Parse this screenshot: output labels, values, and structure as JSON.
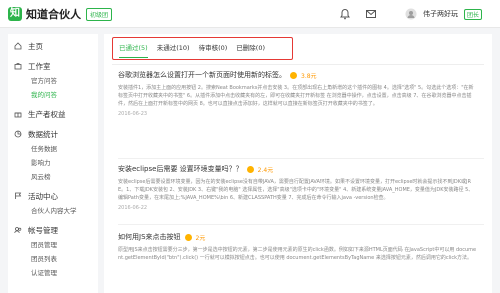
{
  "brand": {
    "logo_char": "知",
    "name": "知道合伙人",
    "badge": "初级团"
  },
  "top_icons": [
    "bell-icon",
    "mail-icon",
    "avatar-icon"
  ],
  "user": {
    "name": "伟子两好玩",
    "badge": "团长"
  },
  "sidebar": {
    "groups": [
      {
        "icon": "home-icon",
        "label": "主页",
        "items": []
      },
      {
        "icon": "briefcase-icon",
        "label": "工作室",
        "items": [
          {
            "label": "官方问答",
            "active": false
          },
          {
            "label": "我的问答",
            "active": true
          }
        ]
      },
      {
        "icon": "gift-icon",
        "label": "生产者权益",
        "items": []
      },
      {
        "icon": "chart-icon",
        "label": "数据统计",
        "items": [
          {
            "label": "任务数据",
            "active": false
          },
          {
            "label": "影响力",
            "active": false
          },
          {
            "label": "风云榜",
            "active": false
          }
        ]
      },
      {
        "icon": "flag-icon",
        "label": "活动中心",
        "items": [
          {
            "label": "合伙人内容大学",
            "active": false
          }
        ]
      },
      {
        "icon": "users-icon",
        "label": "帐号管理",
        "items": [
          {
            "label": "团员管理",
            "active": false
          },
          {
            "label": "团员列表",
            "active": false
          },
          {
            "label": "认证管理",
            "active": false
          }
        ]
      }
    ]
  },
  "tabs": [
    {
      "label": "已通过(5)",
      "active": true
    },
    {
      "label": "未通过(10)",
      "active": false
    },
    {
      "label": "待审核(0)",
      "active": false
    },
    {
      "label": "已删除(0)",
      "active": false
    }
  ],
  "items": [
    {
      "title": "谷歌浏览器怎么设置打开一个新页面时使用新的标签。",
      "money": "3.8元",
      "body": "安装插件1，添加主上面的应用按钮 2。搜索Neat Bookmarks并点击安装 3。在顶部出现右上角新增的这个插件的图标 4。选择\"选项\" 5。勾选此个选项：\"在新标签页中打开收藏夹中的书签\" 6。从插件添加中点击收藏夹有的左，即可在收藏夹打开新标签 在浏览器中操作，点击设置，点击高级 7、在谷歌浏览器中点击插件，然后在上面打开新标签中的网页 8。也可以直接点击添加好，这样就可以直接在新标签页打开收藏夹中的书签了。",
      "date": "2016-06-23"
    },
    {
      "title": "安装eclipse后需要 设置环境变量吗？？",
      "money": "2.4元",
      "body": "安装eclipse后需要设置环境变量，因为在的安装eclipse没有自带JAVA，需要自行配置JAVA环境。如果不设置环境变量，打开eclipse时就会提示找不到JDK或JRE。1、下载JDK安装包 2、安装JDK 3、右键\"我的电脑\" 选择属性，选择\"高级\"选项卡中的\"环境变量\" 4、新建系统变量JAVA_HOME，变量值为JDK安装路径 5、编辑Path变量，在末尾加上;%JAVA_HOME%\\bin 6、新建CLASSPATH变量 7、完成后在命令行输入java -version检查。",
      "date": "2016-06-22"
    },
    {
      "title": "如何用JS来点击按钮",
      "money": "2元",
      "body": "原型用JS来点击按钮需要分三步，第一步是选中按钮的元素，第二步是使用元素的原生的click函数。例如如下来源HTML页面代码 在JavaScript中可以用 document.getElementById(\"btn\").click() 一行就可以模拟按钮点击。也可以使用 document.getElementsByTagName 来选择按钮元素，然后调用它的click方法。",
      "date": ""
    }
  ]
}
